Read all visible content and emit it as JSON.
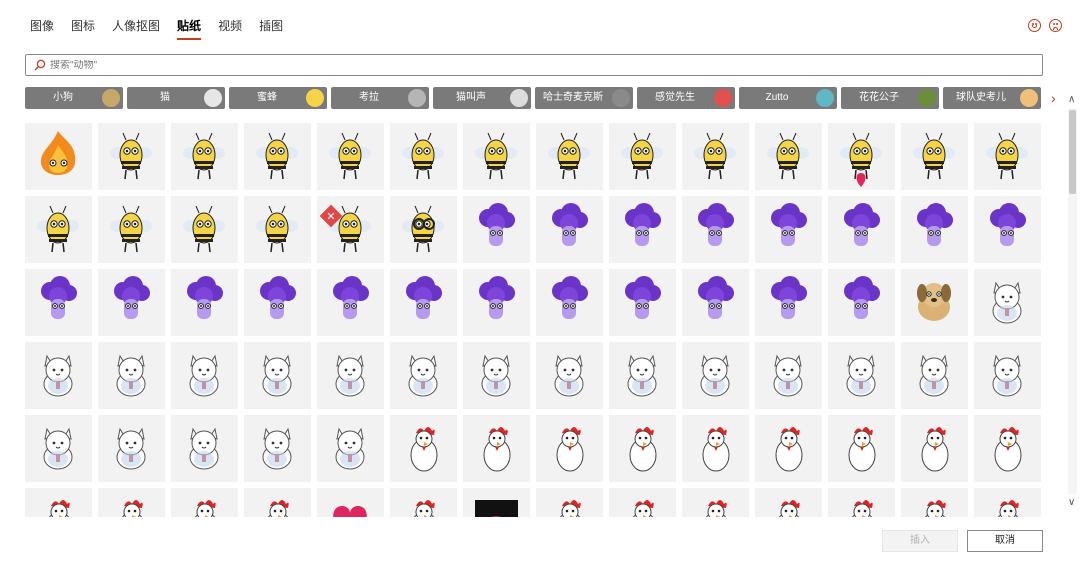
{
  "tabs": [
    "图像",
    "图标",
    "人像抠图",
    "贴纸",
    "视频",
    "插图"
  ],
  "active_tab_index": 3,
  "search": {
    "placeholder": "搜索\"动物\""
  },
  "categories": [
    {
      "label": "小狗",
      "color": "#c8a868"
    },
    {
      "label": "猫",
      "color": "#e6e6e6"
    },
    {
      "label": "蜜蜂",
      "color": "#f5d547"
    },
    {
      "label": "考拉",
      "color": "#b5b5b5"
    },
    {
      "label": "猫叫声",
      "color": "#dcdcdc"
    },
    {
      "label": "哈士奇麦克斯",
      "color": "#8a8a8a"
    },
    {
      "label": "感觉先生",
      "color": "#e35050"
    },
    {
      "label": "Zutto",
      "color": "#5fb8c2"
    },
    {
      "label": "花花公子",
      "color": "#6b8e3a"
    },
    {
      "label": "球队史考儿",
      "color": "#f0c07a"
    }
  ],
  "sticker_rows": [
    [
      "flame",
      "bee",
      "bee",
      "bee",
      "bee",
      "bee",
      "bee",
      "bee",
      "bee",
      "bee",
      "bee",
      "bee-pin",
      "bee",
      "bee"
    ],
    [
      "bee",
      "bee",
      "bee",
      "bee",
      "bee-sign",
      "bee-glasses",
      "blob",
      "blob",
      "blob",
      "blob",
      "blob",
      "blob",
      "blob",
      "blob"
    ],
    [
      "blob",
      "blob",
      "blob",
      "blob",
      "blob",
      "blob",
      "blob",
      "blob",
      "blob",
      "blob",
      "blob",
      "blob",
      "dog",
      "cat"
    ],
    [
      "cat",
      "cat",
      "cat",
      "cat",
      "cat",
      "cat",
      "cat",
      "cat",
      "cat",
      "cat",
      "cat",
      "cat",
      "cat",
      "cat"
    ],
    [
      "cat",
      "cat",
      "cat",
      "cat",
      "cat",
      "chicken",
      "chicken",
      "chicken",
      "chicken",
      "chicken",
      "chicken",
      "chicken",
      "chicken",
      "chicken"
    ],
    [
      "chicken",
      "chicken",
      "chicken",
      "chicken",
      "heart",
      "chicken",
      "dark",
      "chicken",
      "chicken",
      "chicken",
      "chicken",
      "chicken",
      "chicken",
      "chicken"
    ]
  ],
  "buttons": {
    "insert": "插入",
    "cancel": "取消"
  },
  "accent_color": "#c43e1c",
  "icons": {
    "search": "search-icon",
    "happy": "smile-icon",
    "sad": "frown-icon",
    "next": "chevron-right-icon"
  }
}
